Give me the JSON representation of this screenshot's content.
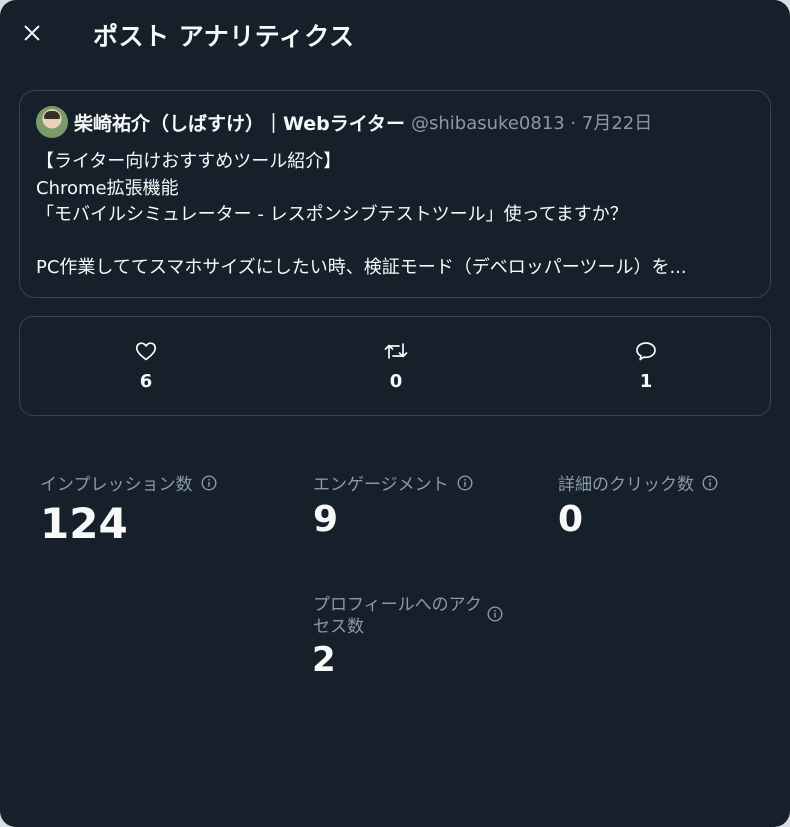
{
  "header": {
    "title": "ポスト アナリティクス",
    "close_icon": "close-icon"
  },
  "post": {
    "author_name": "柴崎祐介（しばすけ）｜Webライター",
    "handle_date": "@shibasuke0813 · 7月22日",
    "lines": [
      "【ライター向けおすすめツール紹介】",
      "Chrome拡張機能",
      "「モバイルシミュレーター - レスポンシブテストツール」使ってますか？",
      "",
      "PC作業しててスマホサイズにしたい時、検証モード（デベロッパーツール）を..."
    ]
  },
  "engagement": {
    "likes": "6",
    "reposts": "0",
    "replies": "1",
    "icons": [
      "heart-icon",
      "repost-icon",
      "reply-icon"
    ]
  },
  "metrics": {
    "impressions": {
      "label": "インプレッション数",
      "value": "124"
    },
    "engagements": {
      "label": "エンゲージメント",
      "value": "9"
    },
    "detail_clicks": {
      "label": "詳細のクリック数",
      "value": "0"
    },
    "profile_visits": {
      "label": "プロフィールへのアクセス数",
      "value": "2"
    }
  },
  "colors": {
    "background": "#15202b",
    "border": "#38444d",
    "text_primary": "#f7f9f9",
    "text_secondary": "#8b98a5"
  }
}
